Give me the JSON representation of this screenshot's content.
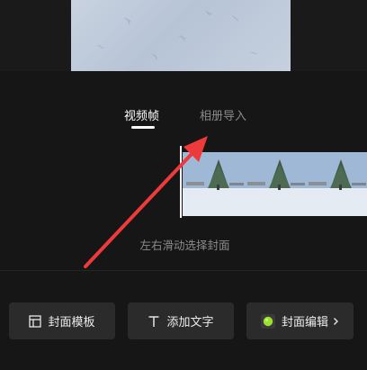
{
  "tabs": {
    "video_frame": "视频帧",
    "album_import": "相册导入",
    "active": "video_frame"
  },
  "hint": "左右滑动选择封面",
  "buttons": {
    "cover_template": "封面模板",
    "add_text": "添加文字",
    "cover_edit": "封面编辑"
  },
  "icons": {
    "cover_template": "layout-template-icon",
    "add_text": "text-t-icon",
    "cover_edit": "green-dot-icon",
    "chevron": "chevron-right-icon"
  },
  "colors": {
    "background": "#161616",
    "active_tab": "#ffffff",
    "inactive_tab": "#8a8a8a",
    "button_bg": "#2b2b2b",
    "annotation_arrow": "#ee3a3a",
    "edit_dot": "#9be22d"
  }
}
